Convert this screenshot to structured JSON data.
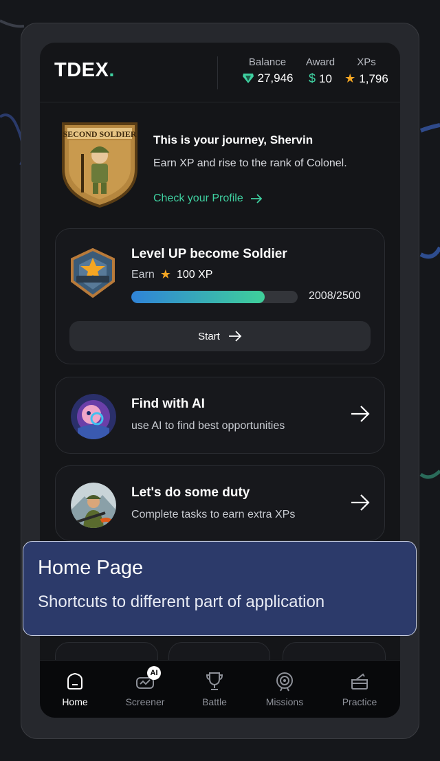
{
  "header": {
    "logo": "TDEX",
    "logo_dot": ".",
    "balance_label": "Balance",
    "balance_value": "27,946",
    "award_label": "Award",
    "award_value": "10",
    "xps_label": "XPs",
    "xps_value": "1,796"
  },
  "journey": {
    "emblem_text": "SECOND SOLDIER",
    "title": "This is your journey, Shervin",
    "subtitle": "Earn XP and rise to the rank of Colonel.",
    "profile_link": "Check your Profile"
  },
  "level": {
    "title": "Level UP become Soldier",
    "earn_label": "Earn",
    "earn_value": "100 XP",
    "progress_text": "2008/2500",
    "progress_fraction": 0.8032,
    "start_label": "Start"
  },
  "ai_card": {
    "title": "Find with AI",
    "subtitle": "use AI to find best opportunities"
  },
  "duty_card": {
    "title": "Let's do some duty",
    "subtitle": "Complete tasks to earn extra XPs"
  },
  "tabs": [
    {
      "label": "Home",
      "icon": "home-icon",
      "active": true
    },
    {
      "label": "Screener",
      "icon": "screener-icon",
      "badge": "AI"
    },
    {
      "label": "Battle",
      "icon": "trophy-icon"
    },
    {
      "label": "Missions",
      "icon": "target-icon"
    },
    {
      "label": "Practice",
      "icon": "practice-icon"
    }
  ],
  "tooltip": {
    "title": "Home Page",
    "body": "Shortcuts to different part of application"
  },
  "colors": {
    "accent": "#3fd0a0",
    "star": "#f5a623",
    "tooltip_bg": "#2c3a6a"
  }
}
